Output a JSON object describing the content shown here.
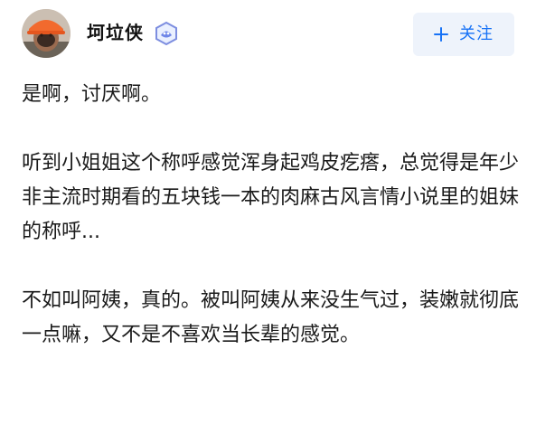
{
  "author": {
    "name": "坷垃侠",
    "avatar_icon": "avatar-person-orange-hardhat",
    "badge_icon": "blue-hexagon-badge-icon"
  },
  "follow_button": {
    "label": "关注",
    "icon": "plus-icon"
  },
  "colors": {
    "accent": "#1772f6",
    "button_bg": "#eef3fb",
    "text": "#1a1a1a"
  },
  "content": {
    "paragraphs": [
      "是啊，讨厌啊。",
      "听到小姐姐这个称呼感觉浑身起鸡皮疙瘩，总觉得是年少非主流时期看的五块钱一本的肉麻古风言情小说里的姐妹的称呼...",
      "不如叫阿姨，真的。被叫阿姨从来没生气过，装嫩就彻底一点嘛，又不是不喜欢当长辈的感觉。"
    ]
  }
}
